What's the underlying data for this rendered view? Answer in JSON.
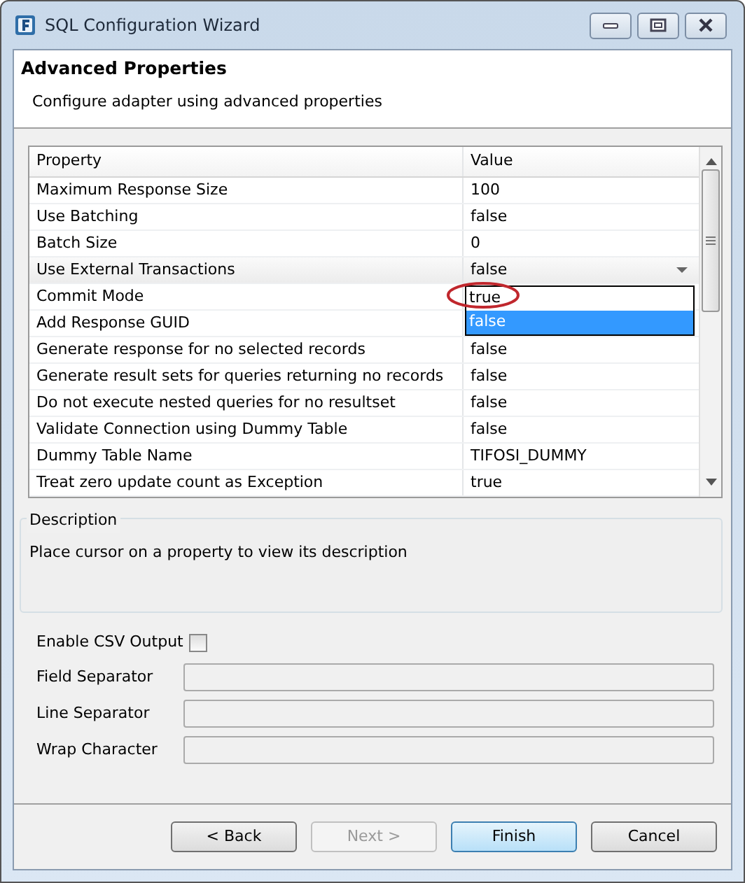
{
  "window": {
    "title": "SQL Configuration Wizard"
  },
  "header": {
    "title": "Advanced Properties",
    "subtitle": "Configure adapter using advanced properties"
  },
  "table": {
    "columns": [
      "Property",
      "Value"
    ],
    "rows": [
      {
        "property": "Maximum Response Size",
        "value": "100",
        "editing": false
      },
      {
        "property": "Use Batching",
        "value": "false",
        "editing": false
      },
      {
        "property": "Batch Size",
        "value": "0",
        "editing": false
      },
      {
        "property": "Use External Transactions",
        "value": "false",
        "editing": true,
        "options": [
          {
            "label": "true",
            "selected": false,
            "circled": true
          },
          {
            "label": "false",
            "selected": true,
            "circled": false
          }
        ]
      },
      {
        "property": "Commit Mode",
        "editing": false
      },
      {
        "property": "Add Response GUID",
        "editing": false
      },
      {
        "property": "Generate response for no selected records",
        "value": "false",
        "editing": false
      },
      {
        "property": "Generate result sets for queries returning no records",
        "value": "false",
        "editing": false
      },
      {
        "property": "Do not execute nested queries for no resultset",
        "value": "false",
        "editing": false
      },
      {
        "property": "Validate Connection using Dummy Table",
        "value": "false",
        "editing": false
      },
      {
        "property": "Dummy Table Name",
        "value": "TIFOSI_DUMMY",
        "editing": false
      },
      {
        "property": "Treat zero update count as Exception",
        "value": "true",
        "editing": false
      }
    ]
  },
  "description": {
    "title": "Description",
    "text": "Place cursor on a property to view its description"
  },
  "csv": {
    "label": "Enable CSV Output",
    "checked": false,
    "fields": [
      {
        "label": "Field Separator",
        "disabled": true
      },
      {
        "label": "Line Separator",
        "disabled": true
      },
      {
        "label": "Wrap Character",
        "disabled": true
      }
    ]
  },
  "buttons": [
    {
      "label": "< Back",
      "disabled": false,
      "default": false
    },
    {
      "label": "Next >",
      "disabled": true,
      "default": false
    },
    {
      "label": "Finish",
      "disabled": false,
      "default": true
    },
    {
      "label": "Cancel",
      "disabled": false,
      "default": false
    }
  ]
}
